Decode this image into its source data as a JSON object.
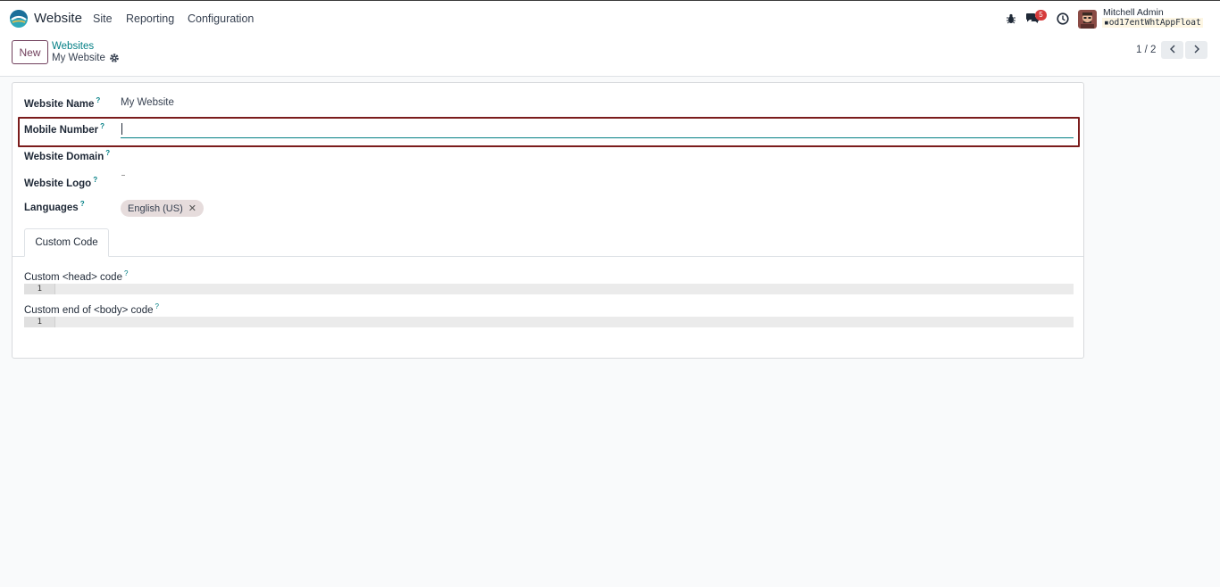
{
  "navbar": {
    "app_name": "Website",
    "menu": [
      "Site",
      "Reporting",
      "Configuration"
    ],
    "messages_badge": "5",
    "user_name": "Mitchell Admin",
    "database": "od17entWhtAppFloat"
  },
  "control_panel": {
    "new_label": "New",
    "breadcrumb_parent": "Websites",
    "breadcrumb_current": "My Website",
    "pager": "1 / 2"
  },
  "form": {
    "website_name_label": "Website Name",
    "website_name_value": "My Website",
    "mobile_number_label": "Mobile Number",
    "mobile_number_value": "",
    "website_domain_label": "Website Domain",
    "website_logo_label": "Website Logo",
    "languages_label": "Languages",
    "languages": [
      "English (US)"
    ],
    "help_mark": "?"
  },
  "tabs": [
    {
      "label": "Custom Code",
      "active": true
    }
  ],
  "custom_code": {
    "head_label": "Custom <head> code",
    "body_label": "Custom end of <body> code",
    "line_number": "1"
  },
  "colors": {
    "accent": "#017e84",
    "primary": "#71405d",
    "highlight_border": "#7b1c1c",
    "badge": "#d63b3b"
  },
  "icons": [
    "app-logo-icon",
    "bug-icon",
    "chat-icon",
    "clock-icon",
    "gear-icon",
    "chevron-left-icon",
    "chevron-right-icon",
    "close-icon",
    "database-icon"
  ]
}
